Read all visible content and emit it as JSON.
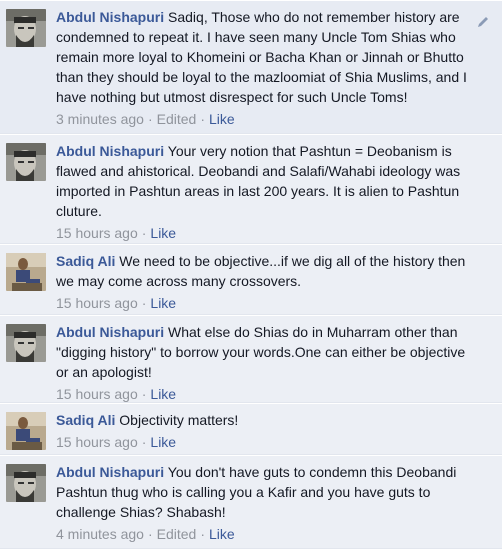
{
  "comments": [
    {
      "author": "Abdul Nishapuri",
      "text": "Sadiq, Those who do not remember history are condemned to repeat it. I have seen many Uncle Tom Shias who remain more loyal to Khomeini or Bacha Khan or Jinnah or Bhutto than they should be loyal to the mazloomiat of Shia Muslims, and I have nothing but utmost disrespect for such Uncle Toms!",
      "time": "3 minutes ago",
      "edited": "Edited",
      "like": "Like",
      "avatar": "profile-photo-bearded-man"
    },
    {
      "author": "Abdul Nishapuri",
      "text": "Your very notion that Pashtun = Deobanism is flawed and ahistorical. Deobandi and Salafi/Wahabi ideology was imported in Pashtun areas in last 200 years. It is alien to Pashtun cluture.",
      "time": "15 hours ago",
      "like": "Like",
      "avatar": "profile-photo-bearded-man"
    },
    {
      "author": "Sadiq Ali",
      "text": "We need to be objective...if we dig all of the history then we may come across many crossovers.",
      "time": "15 hours ago",
      "like": "Like",
      "avatar": "profile-photo-seated-man"
    },
    {
      "author": "Abdul Nishapuri",
      "text": "What else do Shias do in Muharram other than \"digging history\" to borrow your words.One can either be objective or an apologist!",
      "time": "15 hours ago",
      "like": "Like",
      "avatar": "profile-photo-bearded-man"
    },
    {
      "author": "Sadiq Ali",
      "text": "Objectivity matters!",
      "time": "15 hours ago",
      "like": "Like",
      "avatar": "profile-photo-seated-man"
    },
    {
      "author": "Abdul Nishapuri",
      "text": "You don't have guts to condemn this Deobandi Pashtun thug who is calling you a Kafir and you have guts to challenge Shias? Shabash!",
      "time": "4 minutes ago",
      "edited": "Edited",
      "like": "Like",
      "avatar": "profile-photo-bearded-man"
    }
  ],
  "separator": "·",
  "colors": {
    "author": "#3b5998",
    "text": "#141823",
    "meta": "#90949c",
    "background": "#eceff5"
  }
}
